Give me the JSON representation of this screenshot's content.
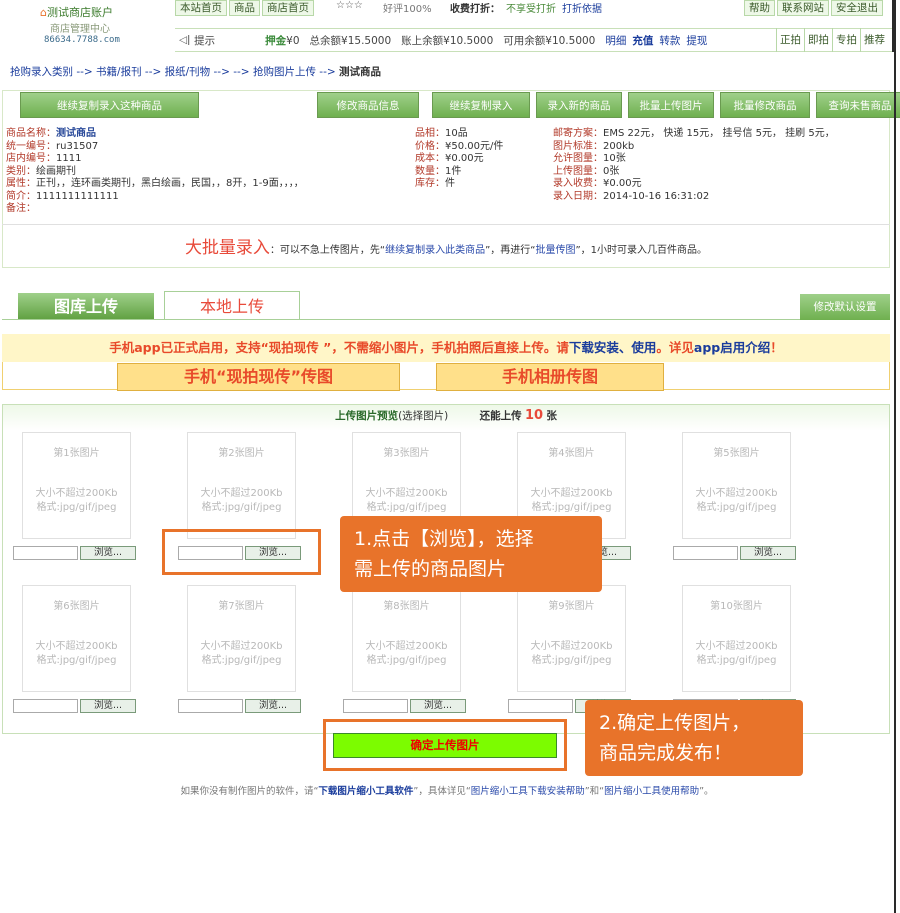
{
  "header": {
    "logo_title": "测试商店账户",
    "logo_sub": "商店管理中心",
    "domain": "86634.7788.com",
    "nav_left": [
      "本站首页",
      "商品",
      "商店首页"
    ],
    "stars": "☆☆☆",
    "praise": "好评100%",
    "fee_label": "收费打折：",
    "fee_value": "不享受打折",
    "fee_link": "打折依据",
    "nav_right": [
      "帮助",
      "联系网站",
      "安全退出"
    ],
    "tip": "提示",
    "deposit": "押金",
    "deposit_val": "¥0",
    "total": "总余额¥15.5000",
    "account": "账上余额¥10.5000",
    "available": "可用余额¥10.5000",
    "detail": "明细",
    "recharge": "充值",
    "transfer": "转款",
    "withdraw": "提现",
    "nav_right2": [
      "正拍",
      "即拍",
      "专拍",
      "推荐"
    ]
  },
  "breadcrumb": {
    "path": "抢购录入类别 --> 书籍/报刊 --> 报纸/刊物 --> --> 抢购图片上传 -->",
    "current": "测试商品"
  },
  "buttons": [
    "继续复制录入这种商品",
    "修改商品信息",
    "继续复制录入",
    "录入新的商品",
    "批量上传图片",
    "批量修改商品",
    "查询未售商品"
  ],
  "product": {
    "left": [
      {
        "k": "商品名称：",
        "v": "测试商品"
      },
      {
        "k": "统一编号：",
        "v": "ru31507"
      },
      {
        "k": "店内编号：",
        "v": "1111"
      },
      {
        "k": "类别：",
        "v": "绘画期刊"
      },
      {
        "k": "属性：",
        "v": "正刊，，连环画类期刊，黑白绘画，民国，，8开，1-9面，，，，"
      },
      {
        "k": "简介：",
        "v": "1111111111111"
      },
      {
        "k": "备注：",
        "v": ""
      }
    ],
    "mid": [
      {
        "k": "品相：",
        "v": "10品"
      },
      {
        "k": "价格：",
        "v": "¥50.00元/件"
      },
      {
        "k": "成本：",
        "v": "¥0.00元"
      },
      {
        "k": "数量：",
        "v": "1件"
      },
      {
        "k": "库存：",
        "v": "件"
      }
    ],
    "right": [
      {
        "k": "邮寄方案：",
        "v": "EMS 22元， 快递 15元， 挂号信 5元， 挂刷 5元，"
      },
      {
        "k": "图片标准：",
        "v": "200kb"
      },
      {
        "k": "允许图量：",
        "v": "10张"
      },
      {
        "k": "上传图量：",
        "v": "0张"
      },
      {
        "k": "录入收费：",
        "v": "¥0.00元"
      },
      {
        "k": "录入日期：",
        "v": "2014-10-16 16:31:02"
      }
    ]
  },
  "bulk": {
    "big": "大批量录入",
    "t1": "：可以不急上传图片，先“",
    "l1": "继续复制录入此类商品",
    "t2": "”，再进行“",
    "l2": "批量传图",
    "t3": "”，1小时可录入几百件商品。"
  },
  "tabs": {
    "library": "图库上传",
    "local": "本地上传",
    "settings": "修改默认设置"
  },
  "app": {
    "notice_a": "手机app已正式启用，支持“现拍现传 ”，不需缩小图片，手机拍照后直接上传。请",
    "notice_link": "下载安装、使用",
    "notice_b": "。详见",
    "notice_link2": "app启用介绍",
    "notice_c": "！",
    "btn1": "手机“现拍现传”传图",
    "btn2": "手机相册传图"
  },
  "upload": {
    "title": "上传图片预览",
    "hint": "(选择图片)",
    "remain_label": "还能上传",
    "remain_num": "10",
    "remain_unit": "张",
    "slots": [
      {
        "label": "第1张图片"
      },
      {
        "label": "第2张图片"
      },
      {
        "label": "第3张图片"
      },
      {
        "label": "第4张图片"
      },
      {
        "label": "第5张图片"
      },
      {
        "label": "第6张图片"
      },
      {
        "label": "第7张图片"
      },
      {
        "label": "第8张图片"
      },
      {
        "label": "第9张图片"
      },
      {
        "label": "第10张图片"
      }
    ],
    "size_text": "大小不超过200Kb",
    "format_text": "格式:jpg/gif/jpeg",
    "browse": "浏览...",
    "confirm": "确定上传图片"
  },
  "callouts": {
    "c1_line1": "1.点击【浏览】，选择",
    "c1_line2": "需上传的商品图片",
    "c2_line1": "2.确定上传图片，",
    "c2_line2": "商品完成发布！"
  },
  "footer": {
    "t1": "如果你没有制作图片的软件，请“",
    "l1": "下载图片缩小工具软件",
    "t2": "”，具体详见“",
    "l2": "图片缩小工具下载安装帮助",
    "t3": "”和“",
    "l3": "图片缩小工具使用帮助",
    "t4": "”。"
  },
  "colors": {
    "accent_green": "#6fb04f",
    "callout_orange": "#e8732a",
    "notice_red": "#e84a2a",
    "confirm_green": "#7cfc00"
  }
}
